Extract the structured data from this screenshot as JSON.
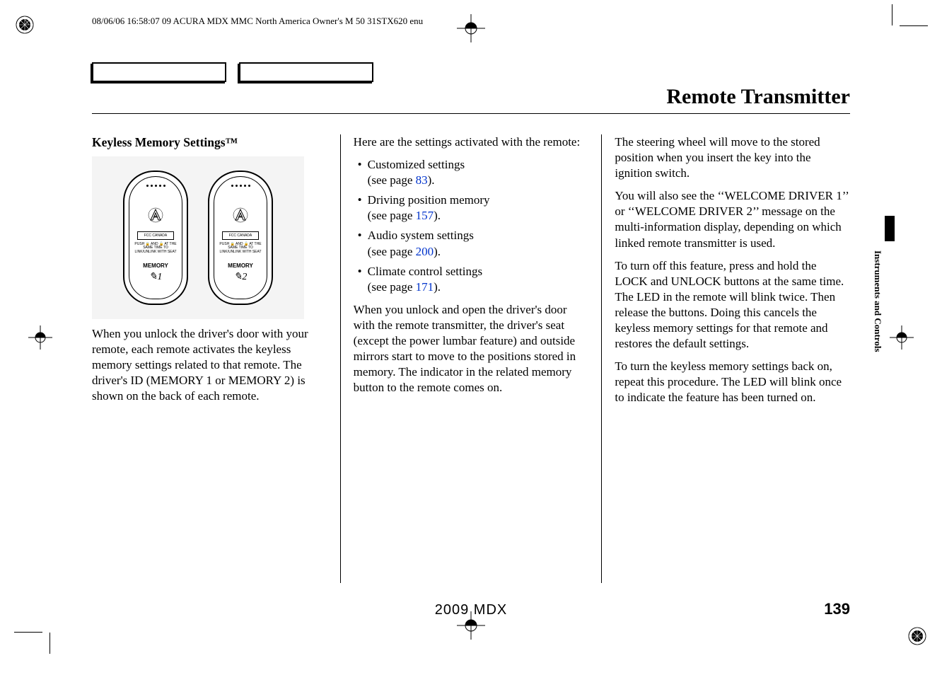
{
  "header_meta": "08/06/06 16:58:07   09 ACURA MDX MMC North America Owner's M 50 31STX620 enu",
  "page_title": "Remote Transmitter",
  "side_tab": "Instruments and Controls",
  "footer": {
    "model": "2009  MDX",
    "page_number": "139"
  },
  "col1": {
    "heading": "Keyless Memory Settings™",
    "remote": {
      "small_label": "FCC CANADA",
      "small_text": "PUSH 🔒 AND 🔓 AT THE SAME TIME TO LINK/UNLINK WITH SEAT",
      "memory": "MEMORY",
      "num1": "1",
      "num2": "2"
    },
    "p1": "When you unlock the driver's door with your remote, each remote activates the keyless memory settings related to that remote. The driver's ID (MEMORY 1 or MEMORY 2) is shown on the back of each remote."
  },
  "col2": {
    "intro": "Here are the settings activated with the remote:",
    "items": [
      {
        "text": "Customized settings",
        "page_prefix": "(see page ",
        "page": "83",
        "page_suffix": ")."
      },
      {
        "text": "Driving position memory",
        "page_prefix": "(see page ",
        "page": "157",
        "page_suffix": ")."
      },
      {
        "text": "Audio system settings",
        "page_prefix": "(see page ",
        "page": "200",
        "page_suffix": ")."
      },
      {
        "text": "Climate control settings",
        "page_prefix": "(see page ",
        "page": "171",
        "page_suffix": ")."
      }
    ],
    "p2": "When you unlock and open the driver's door with the remote transmitter, the driver's seat (except the power lumbar feature) and outside mirrors start to move to the positions stored in memory. The indicator in the related memory button to the remote comes on."
  },
  "col3": {
    "p1": "The steering wheel will move to the stored position when you insert the key into the ignition switch.",
    "p2": "You will also see the ‘‘WELCOME DRIVER 1’’ or ‘‘WELCOME DRIVER 2’’ message on the multi-information display, depending on which linked remote transmitter is used.",
    "p3": "To turn off this feature, press and hold the LOCK and UNLOCK buttons at the same time. The LED in the remote will blink twice. Then release the buttons. Doing this cancels the keyless memory settings for that remote and restores the default settings.",
    "p4": "To turn the keyless memory settings back on, repeat this procedure. The LED will blink once to indicate the feature has been turned on."
  }
}
